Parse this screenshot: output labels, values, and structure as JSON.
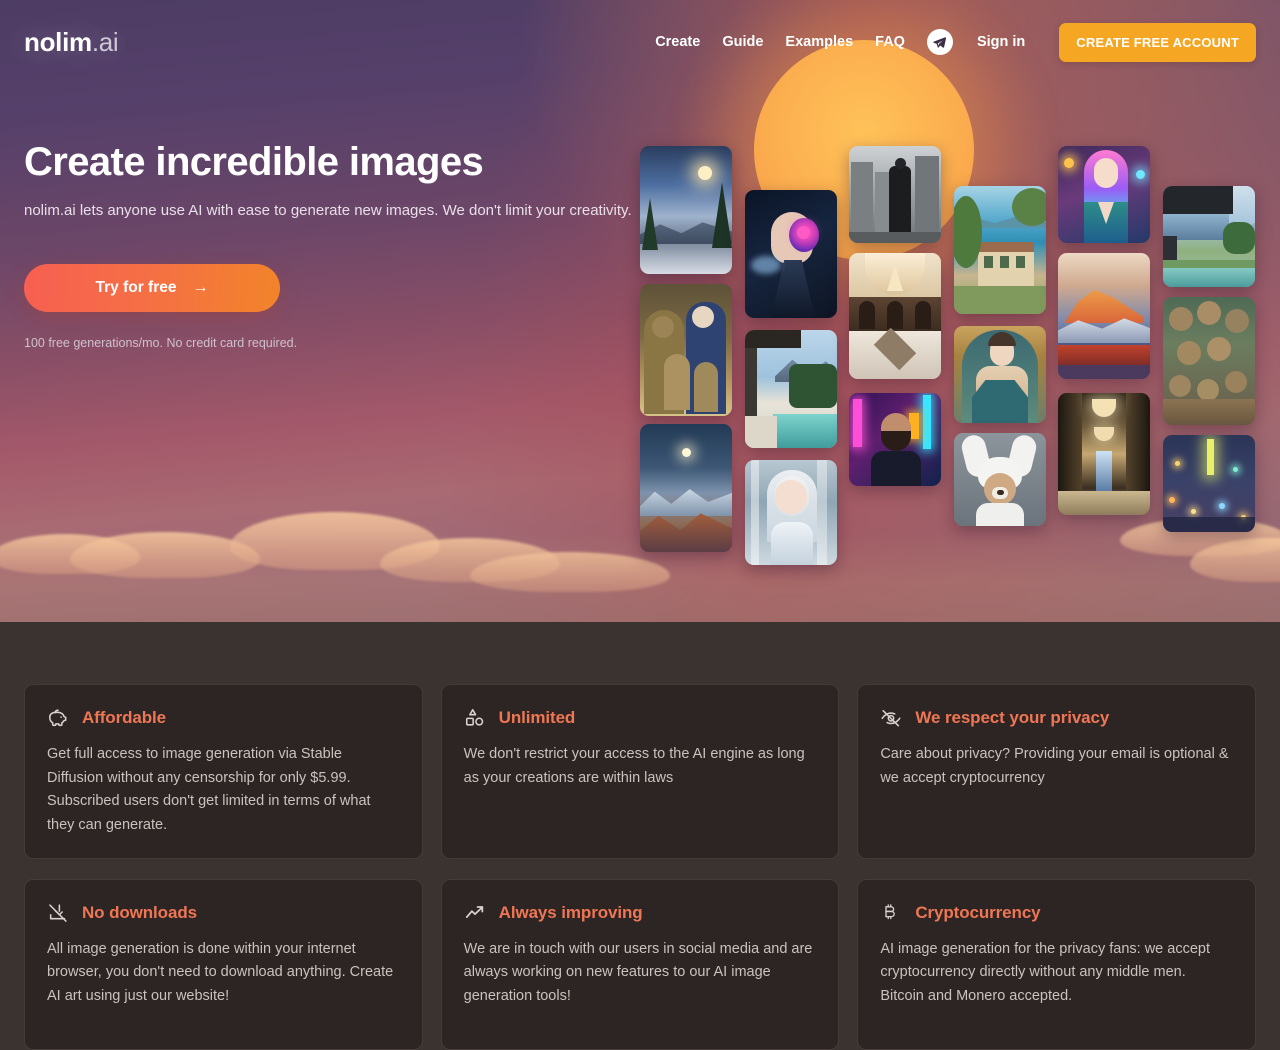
{
  "brand": {
    "name": "nolim",
    "suffix": ".ai"
  },
  "nav": {
    "links": [
      {
        "label": "Create"
      },
      {
        "label": "Guide"
      },
      {
        "label": "Examples"
      },
      {
        "label": "FAQ"
      }
    ],
    "telegram_icon": "telegram-icon",
    "signin_label": "Sign in",
    "cta_label": "CREATE FREE ACCOUNT"
  },
  "hero": {
    "title": "Create incredible images",
    "subtitle": "nolim.ai lets anyone use AI with ease to generate new images. We don't limit your creativity.",
    "cta_label": "Try for free",
    "cta_arrow": "→",
    "fineprint": "100 free generations/mo. No credit card required."
  },
  "collage": {
    "items": [
      {
        "name": "snowy-mountain-sunrise",
        "alt": "Snowy mountain valley at sunrise with pine trees"
      },
      {
        "name": "monkey-family-painting",
        "alt": "Renaissance style painting of a monkey family"
      },
      {
        "name": "moonlit-mountain-range",
        "alt": "Moonlit snow covered mountain range"
      },
      {
        "name": "cyborg-woman-portrait",
        "alt": "Futuristic cyborg woman with glowing neural implant"
      },
      {
        "name": "modern-house-pool-mountains",
        "alt": "Modern glass house with pool facing mountains"
      },
      {
        "name": "white-haired-woman-winter",
        "alt": "White haired woman in winter forest"
      },
      {
        "name": "suited-man-ruined-city",
        "alt": "Man in suit standing in ruined monochrome city"
      },
      {
        "name": "ornate-dome-lobby",
        "alt": "Ornate luxury hotel lobby with domed chandelier"
      },
      {
        "name": "bearded-man-neon-city",
        "alt": "Bearded man in neon lit cyberpunk street"
      },
      {
        "name": "lakeside-villa",
        "alt": "Mediterranean villa overlooking a blue lake"
      },
      {
        "name": "classical-woman-portrait",
        "alt": "Classical oil portrait of a woman in teal dress"
      },
      {
        "name": "dog-in-bunny-hat",
        "alt": "Small dog wearing a white bunny ear hat"
      },
      {
        "name": "pink-haired-woman-city",
        "alt": "Pink and blue haired woman in city lights"
      },
      {
        "name": "red-snow-peak",
        "alt": "Snow capped peak glowing red at sunset"
      },
      {
        "name": "grand-hallway-chandeliers",
        "alt": "Grand golden hallway with chandeliers"
      },
      {
        "name": "modern-villa-poolside",
        "alt": "Modern villa with infinity pool and mountain view"
      },
      {
        "name": "monkey-group-portrait",
        "alt": "Group portrait of many monkeys together"
      },
      {
        "name": "night-city-lights",
        "alt": "Abstract night city with glowing lights"
      }
    ]
  },
  "features": {
    "cards": [
      {
        "icon": "piggy-bank-icon",
        "title": "Affordable",
        "body": "Get full access to image generation via Stable Diffusion without any censorship for only $5.99. Subscribed users don't get limited in terms of what they can generate."
      },
      {
        "icon": "shapes-icon",
        "title": "Unlimited",
        "body": "We don't restrict your access to the AI engine as long as your creations are within laws"
      },
      {
        "icon": "eye-off-icon",
        "title": "We respect your privacy",
        "body": "Care about privacy? Providing your email is optional & we accept cryptocurrency"
      },
      {
        "icon": "download-off-icon",
        "title": "No downloads",
        "body": "All image generation is done within your internet browser, you don't need to download anything. Create AI art using just our website!"
      },
      {
        "icon": "trending-up-icon",
        "title": "Always improving",
        "body": "We are in touch with our users in social media and are always working on new features to our AI image generation tools!"
      },
      {
        "icon": "bitcoin-icon",
        "title": "Cryptocurrency",
        "body": "AI image generation for the privacy fans: we accept cryptocurrency directly without any middle men. Bitcoin and Monero accepted."
      }
    ]
  },
  "colors": {
    "accent_orange": "#f5a623",
    "cta_gradient_start": "#f75f52",
    "cta_gradient_end": "#f2842a",
    "card_title": "#ef7654",
    "dark_section": "#3a332f",
    "card_bg": "#2c2523"
  }
}
